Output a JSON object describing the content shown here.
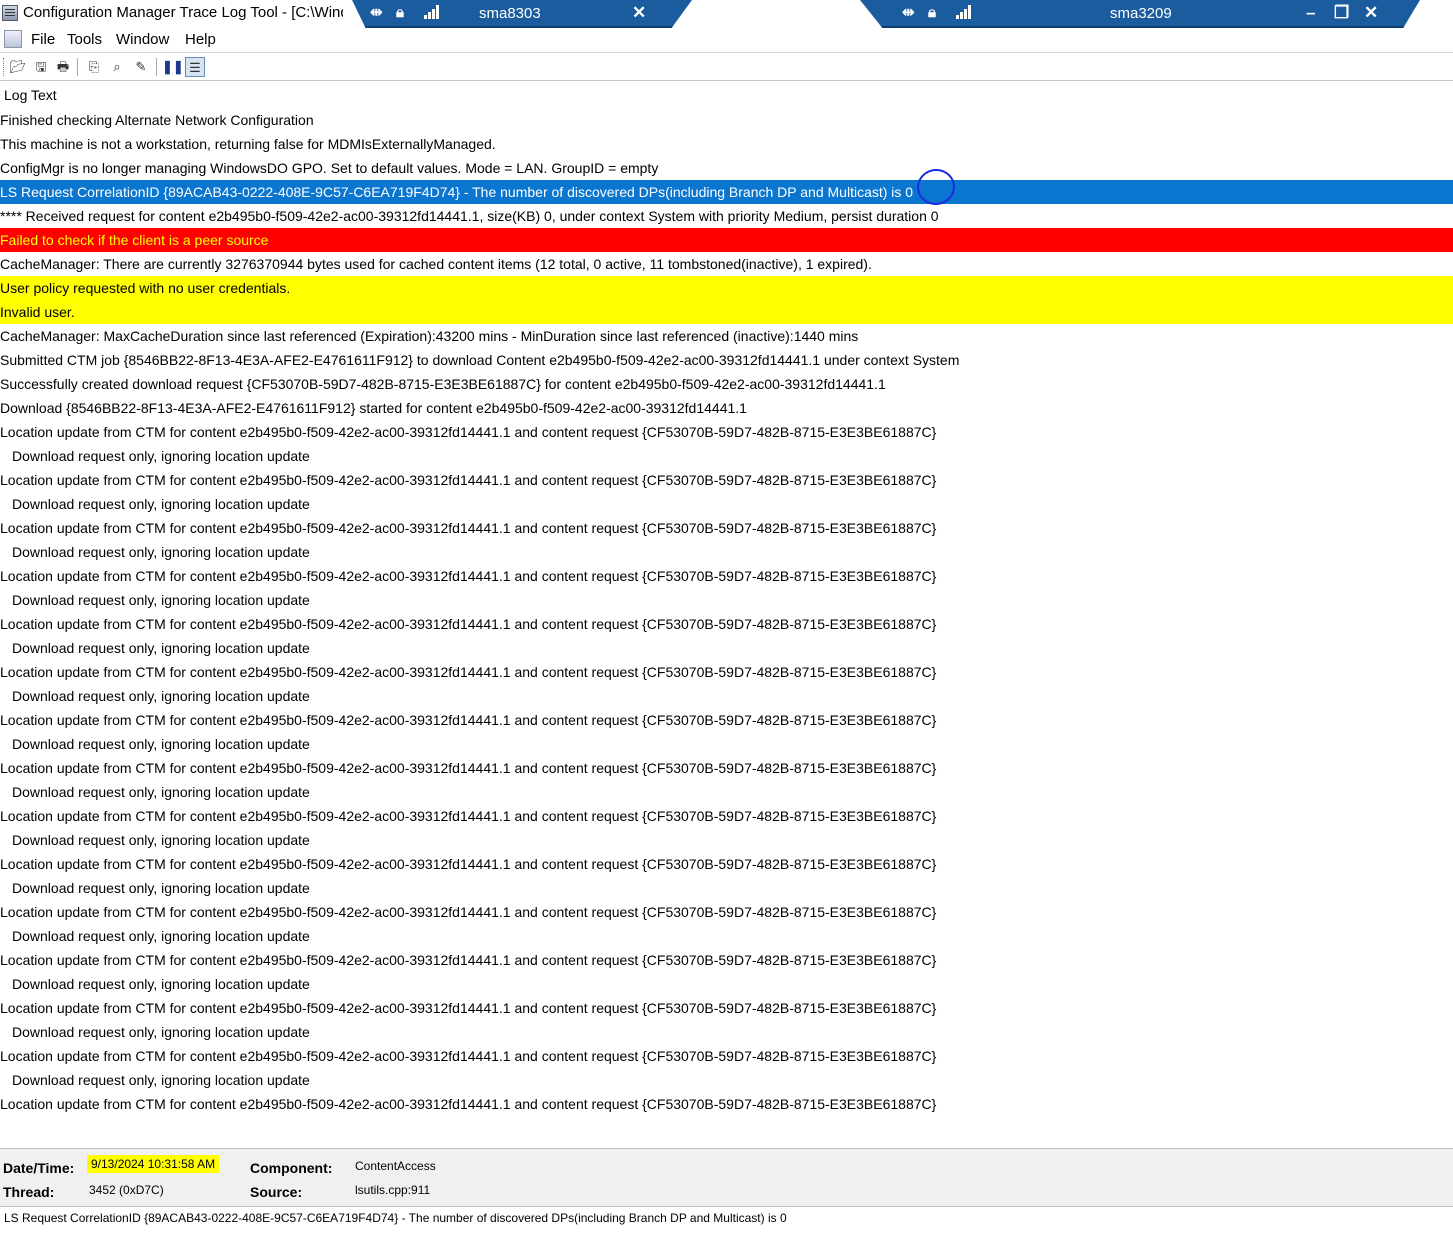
{
  "window": {
    "title": "Configuration Manager Trace Log Tool - [C:\\Windows\\CCM\\Logs\\ContentTransferManager.log]",
    "rdp_sessions": [
      {
        "name": "sma8303",
        "close_icon": "close-icon"
      },
      {
        "name": "sma3209",
        "controls": [
          "minimize-icon",
          "restore-icon",
          "close-icon"
        ]
      }
    ]
  },
  "menu": {
    "file": "File",
    "tools": "Tools",
    "window": "Window",
    "help": "Help"
  },
  "toolbar": {
    "icons": [
      "open-icon",
      "save-icon",
      "print-icon",
      "copy-icon",
      "find-icon",
      "highlight-icon",
      "pause-icon",
      "details-icon"
    ]
  },
  "log": {
    "header": "Log Text",
    "rows": [
      {
        "text": "Finished checking Alternate Network Configuration",
        "type": "normal"
      },
      {
        "text": "This machine is not a workstation, returning false for MDMIsExternallyManaged.",
        "type": "normal"
      },
      {
        "text": "ConfigMgr is no longer managing WindowsDO GPO.  Set to default values. Mode = LAN. GroupID = empty",
        "type": "normal"
      },
      {
        "text": "LS Request CorrelationID {89ACAB43-0222-408E-9C57-C6EA719F4D74} - The number of discovered DPs(including Branch DP and Multicast) is 0",
        "type": "selected"
      },
      {
        "text": "**** Received request for content e2b495b0-f509-42e2-ac00-39312fd14441.1, size(KB) 0, under context System with priority Medium, persist duration 0",
        "type": "normal"
      },
      {
        "text": "Failed to check if the client is a peer source",
        "type": "error"
      },
      {
        "text": "CacheManager: There are currently 3276370944 bytes used for cached content items (12 total, 0 active, 11 tombstoned(inactive), 1 expired).",
        "type": "normal"
      },
      {
        "text": "User policy requested with no user credentials.",
        "type": "warning"
      },
      {
        "text": "Invalid user.",
        "type": "warning"
      },
      {
        "text": "CacheManager: MaxCacheDuration since last referenced (Expiration):43200 mins - MinDuration since last referenced (inactive):1440 mins",
        "type": "normal"
      },
      {
        "text": "Submitted CTM job {8546BB22-8F13-4E3A-AFE2-E4761611F912} to download Content e2b495b0-f509-42e2-ac00-39312fd14441.1 under context System",
        "type": "normal"
      },
      {
        "text": "Successfully created download  request {CF53070B-59D7-482B-8715-E3E3BE61887C} for content e2b495b0-f509-42e2-ac00-39312fd14441.1",
        "type": "normal"
      },
      {
        "text": "Download {8546BB22-8F13-4E3A-AFE2-E4761611F912} started for content e2b495b0-f509-42e2-ac00-39312fd14441.1",
        "type": "normal"
      },
      {
        "text": "Location update from CTM for content e2b495b0-f509-42e2-ac00-39312fd14441.1 and content request {CF53070B-59D7-482B-8715-E3E3BE61887C}",
        "type": "normal"
      },
      {
        "text": "Download request only, ignoring location update",
        "type": "indent"
      },
      {
        "text": "Location update from CTM for content e2b495b0-f509-42e2-ac00-39312fd14441.1 and content request {CF53070B-59D7-482B-8715-E3E3BE61887C}",
        "type": "normal"
      },
      {
        "text": "Download request only, ignoring location update",
        "type": "indent"
      },
      {
        "text": "Location update from CTM for content e2b495b0-f509-42e2-ac00-39312fd14441.1 and content request {CF53070B-59D7-482B-8715-E3E3BE61887C}",
        "type": "normal"
      },
      {
        "text": "Download request only, ignoring location update",
        "type": "indent"
      },
      {
        "text": "Location update from CTM for content e2b495b0-f509-42e2-ac00-39312fd14441.1 and content request {CF53070B-59D7-482B-8715-E3E3BE61887C}",
        "type": "normal"
      },
      {
        "text": "Download request only, ignoring location update",
        "type": "indent"
      },
      {
        "text": "Location update from CTM for content e2b495b0-f509-42e2-ac00-39312fd14441.1 and content request {CF53070B-59D7-482B-8715-E3E3BE61887C}",
        "type": "normal"
      },
      {
        "text": "Download request only, ignoring location update",
        "type": "indent"
      },
      {
        "text": "Location update from CTM for content e2b495b0-f509-42e2-ac00-39312fd14441.1 and content request {CF53070B-59D7-482B-8715-E3E3BE61887C}",
        "type": "normal"
      },
      {
        "text": "Download request only, ignoring location update",
        "type": "indent"
      },
      {
        "text": "Location update from CTM for content e2b495b0-f509-42e2-ac00-39312fd14441.1 and content request {CF53070B-59D7-482B-8715-E3E3BE61887C}",
        "type": "normal"
      },
      {
        "text": "Download request only, ignoring location update",
        "type": "indent"
      },
      {
        "text": "Location update from CTM for content e2b495b0-f509-42e2-ac00-39312fd14441.1 and content request {CF53070B-59D7-482B-8715-E3E3BE61887C}",
        "type": "normal"
      },
      {
        "text": "Download request only, ignoring location update",
        "type": "indent"
      },
      {
        "text": "Location update from CTM for content e2b495b0-f509-42e2-ac00-39312fd14441.1 and content request {CF53070B-59D7-482B-8715-E3E3BE61887C}",
        "type": "normal"
      },
      {
        "text": "Download request only, ignoring location update",
        "type": "indent"
      },
      {
        "text": "Location update from CTM for content e2b495b0-f509-42e2-ac00-39312fd14441.1 and content request {CF53070B-59D7-482B-8715-E3E3BE61887C}",
        "type": "normal"
      },
      {
        "text": "Download request only, ignoring location update",
        "type": "indent"
      },
      {
        "text": "Location update from CTM for content e2b495b0-f509-42e2-ac00-39312fd14441.1 and content request {CF53070B-59D7-482B-8715-E3E3BE61887C}",
        "type": "normal"
      },
      {
        "text": "Download request only, ignoring location update",
        "type": "indent"
      },
      {
        "text": "Location update from CTM for content e2b495b0-f509-42e2-ac00-39312fd14441.1 and content request {CF53070B-59D7-482B-8715-E3E3BE61887C}",
        "type": "normal"
      },
      {
        "text": "Download request only, ignoring location update",
        "type": "indent"
      },
      {
        "text": "Location update from CTM for content e2b495b0-f509-42e2-ac00-39312fd14441.1 and content request {CF53070B-59D7-482B-8715-E3E3BE61887C}",
        "type": "normal"
      },
      {
        "text": "Download request only, ignoring location update",
        "type": "indent"
      },
      {
        "text": "Location update from CTM for content e2b495b0-f509-42e2-ac00-39312fd14441.1 and content request {CF53070B-59D7-482B-8715-E3E3BE61887C}",
        "type": "normal"
      },
      {
        "text": "Download request only, ignoring location update",
        "type": "indent"
      },
      {
        "text": "Location update from CTM for content e2b495b0-f509-42e2-ac00-39312fd14441.1 and content request {CF53070B-59D7-482B-8715-E3E3BE61887C}",
        "type": "normal"
      }
    ]
  },
  "details": {
    "datetime_label": "Date/Time:",
    "datetime_value": "9/13/2024 10:31:58 AM",
    "component_label": "Component:",
    "component_value": "ContentAccess",
    "thread_label": "Thread:",
    "thread_value": "3452 (0xD7C)",
    "source_label": "Source:",
    "source_value": "lsutils.cpp:911"
  },
  "status_text": "LS Request CorrelationID {89ACAB43-0222-408E-9C57-C6EA719F4D74} - The number of discovered DPs(including Branch DP and Multicast) is 0",
  "colors": {
    "selected": "#0b76d0",
    "error": "#ff0000",
    "warning": "#ffff00",
    "rdp_bar": "#1a5c9e"
  }
}
